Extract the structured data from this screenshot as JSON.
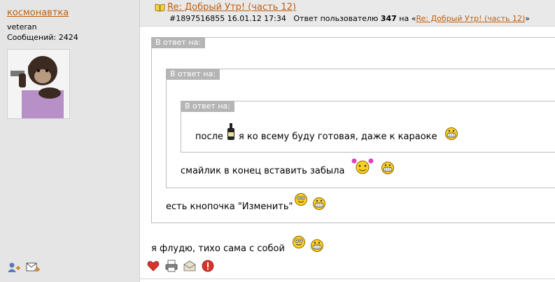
{
  "author": {
    "name": "космонавтка",
    "rank": "veteran",
    "messages": "Сообщений: 2424"
  },
  "post": {
    "title": "Re: Добрый Утр! (часть 12)",
    "id": "#1897516855",
    "datetime": "16.01.12 17:34",
    "reply_prefix": "Ответ пользователю",
    "reply_user": "347",
    "reply_on": "на «",
    "reply_link": "Re: Добрый Утр! (часть 12)",
    "reply_suffix": "»"
  },
  "quotes": {
    "label": "В ответ на:",
    "innermost_text_before": "после",
    "innermost_text_after": "я ко всему буду готовая, даже к караоке",
    "middle_text": "смайлик в конец вставить забыла",
    "outer_text": "есть кнопочка \"Изменить\""
  },
  "reply_text": "я флудю, тихо сама с собой",
  "icons": {
    "sidebar": [
      "add-friend-icon",
      "send-message-icon"
    ],
    "actions": [
      "heart-icon",
      "print-icon",
      "mail-icon",
      "report-icon"
    ]
  },
  "colors": {
    "link": "#c06010",
    "sidebar_bg": "#e5e5e5",
    "quote_label_bg": "#b5b5b5"
  }
}
